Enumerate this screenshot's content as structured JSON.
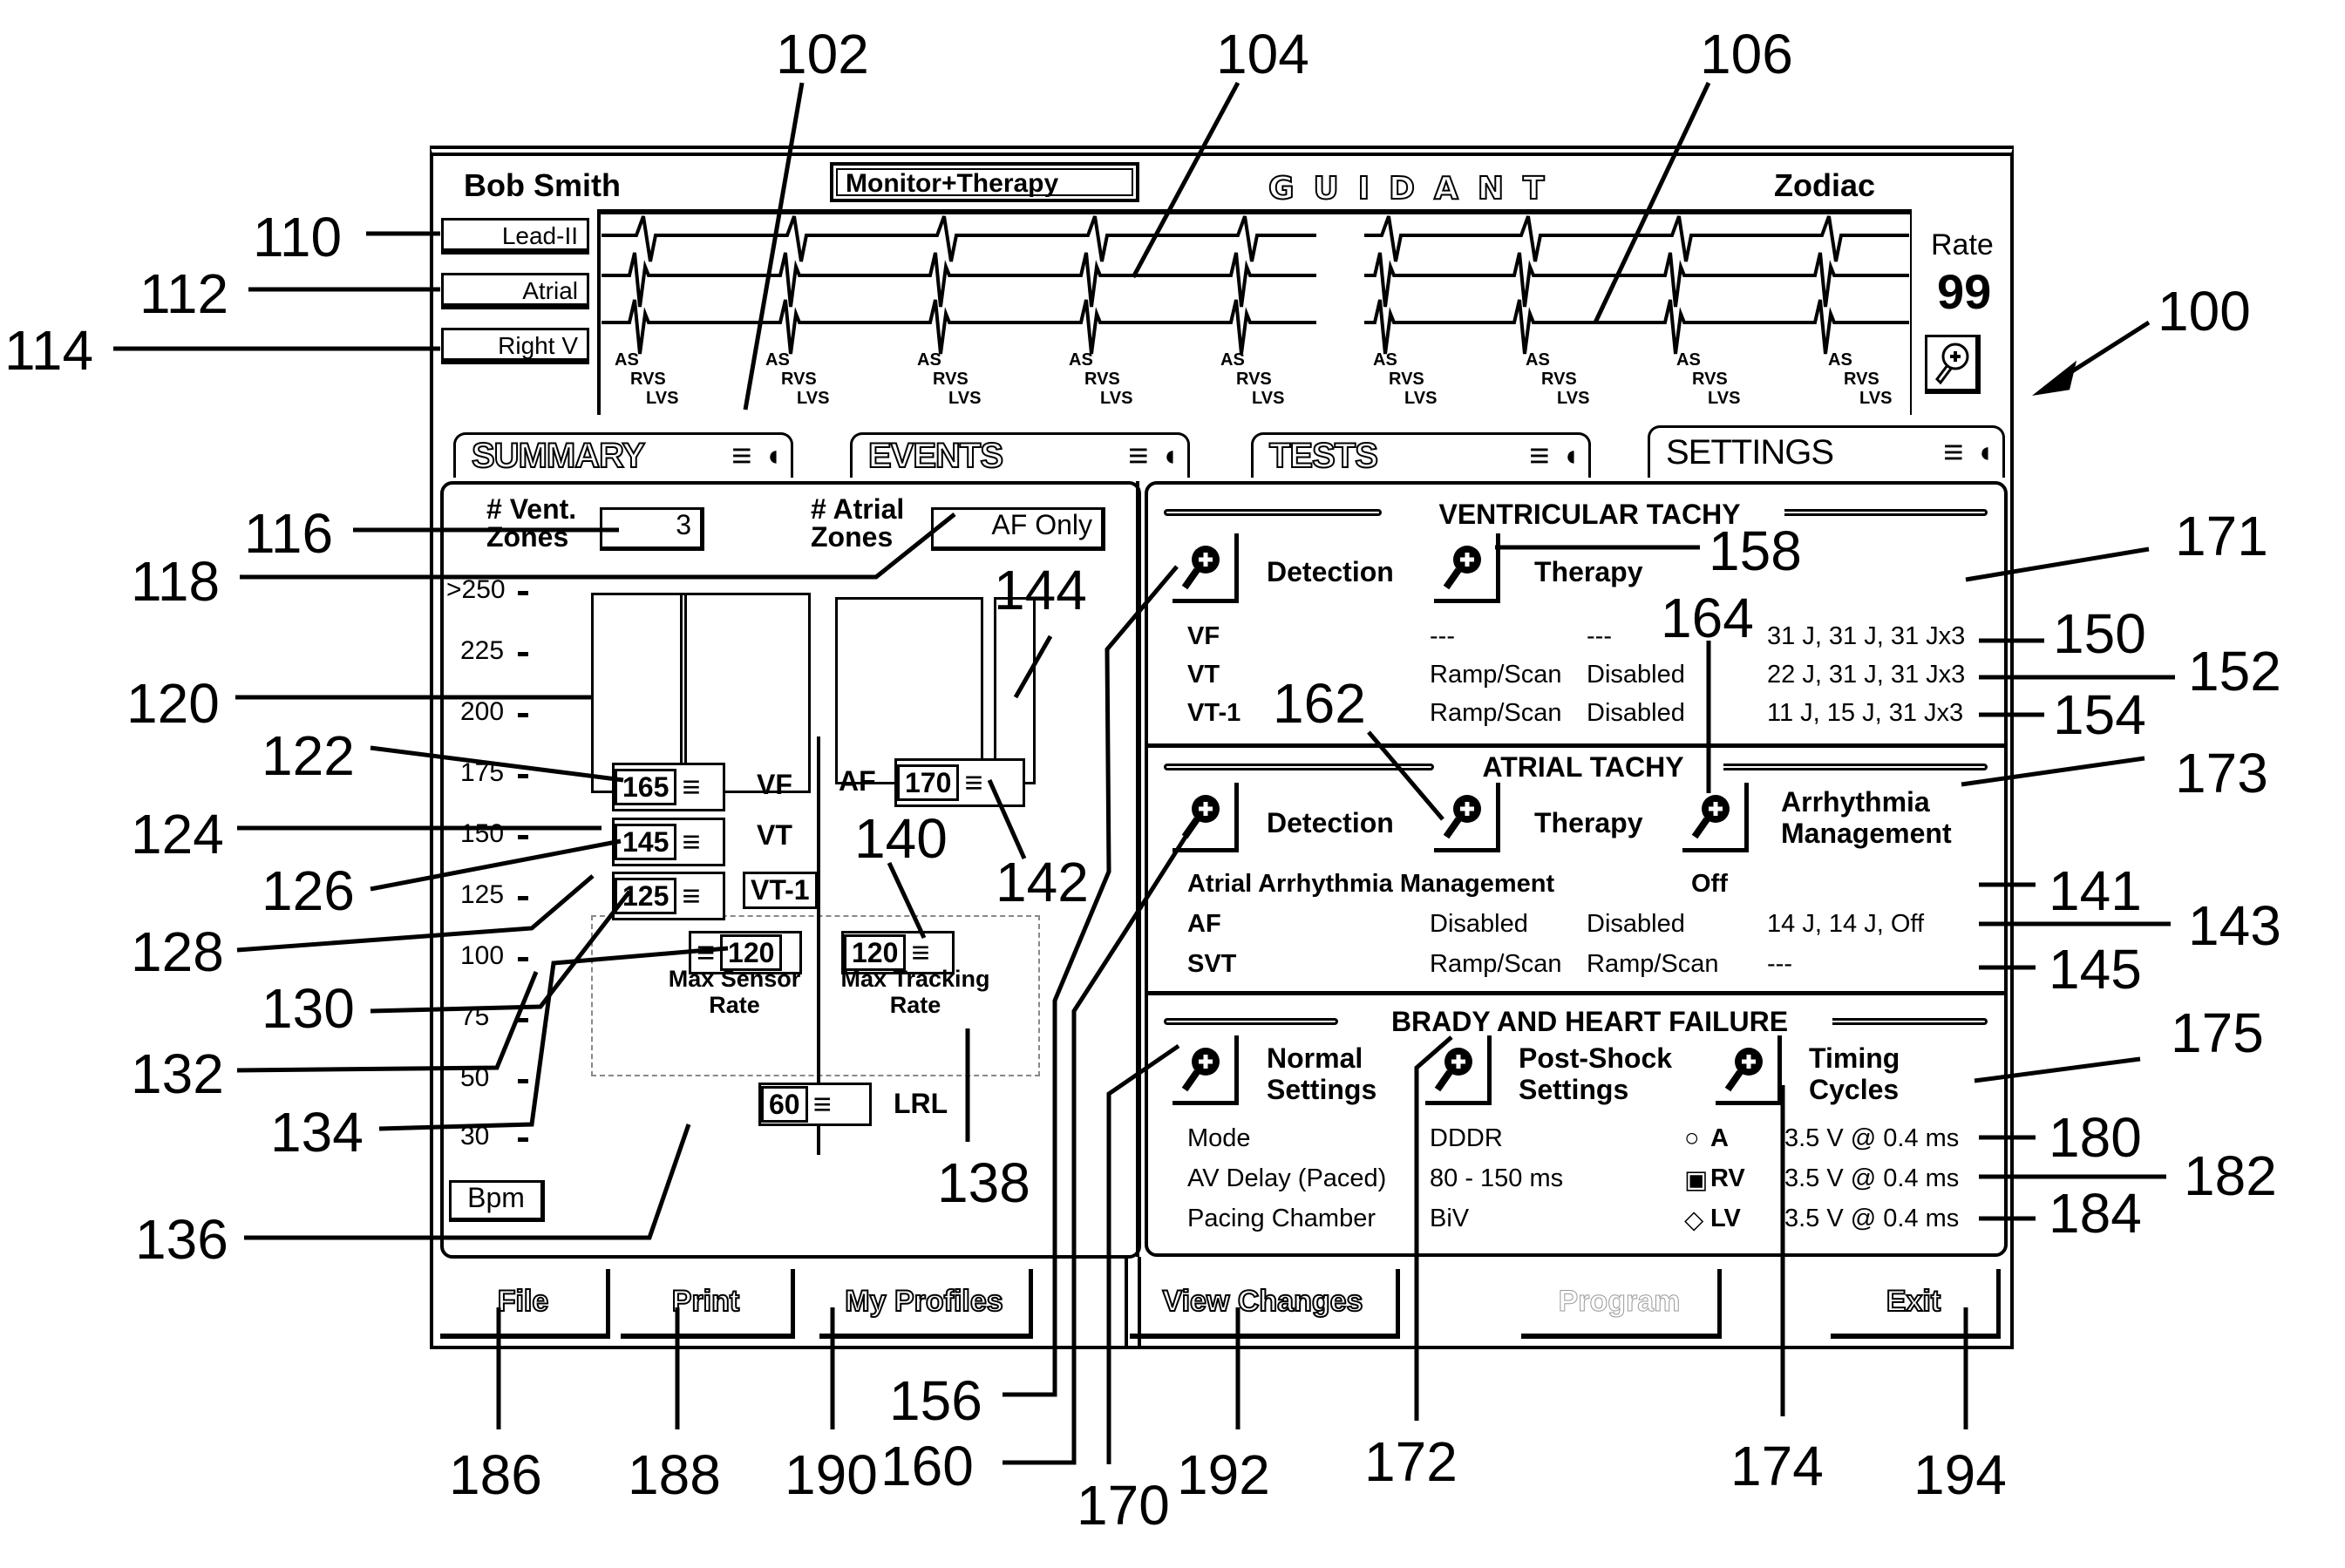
{
  "header": {
    "patient_name": "Bob Smith",
    "mode": "Monitor+Therapy",
    "brand": "GUIDANT",
    "device": "Zodiac"
  },
  "ecg": {
    "lead_buttons": [
      "Lead-II",
      "Atrial",
      "Right V"
    ],
    "markers": [
      {
        "as": "AS",
        "rvs": "RVS",
        "lvs": "LVS"
      },
      {
        "as": "AS",
        "rvs": "RVS",
        "lvs": "LVS"
      },
      {
        "as": "AS",
        "rvs": "RVS",
        "lvs": "LVS"
      },
      {
        "as": "AS",
        "rvs": "RVS",
        "lvs": "LVS"
      },
      {
        "as": "AS",
        "rvs": "RVS",
        "lvs": "LVS"
      },
      {
        "as": "AS",
        "rvs": "RVS",
        "lvs": "LVS"
      },
      {
        "as": "AS",
        "rvs": "RVS",
        "lvs": "LVS"
      },
      {
        "as": "AS",
        "rvs": "RVS",
        "lvs": "LVS"
      },
      {
        "as": "AS",
        "rvs": "RVS",
        "lvs": "LVS"
      }
    ],
    "rate_label": "Rate",
    "rate_value": "99",
    "zoom_icon": "magnifier-icon"
  },
  "tabs": [
    {
      "label": "SUMMARY",
      "active": false
    },
    {
      "label": "EVENTS",
      "active": false
    },
    {
      "label": "TESTS",
      "active": false
    },
    {
      "label": "SETTINGS",
      "active": true
    }
  ],
  "zones": {
    "vent_label_1": "# Vent.",
    "vent_label_2": "Zones",
    "vent_value": "3",
    "atrial_label_1": "# Atrial",
    "atrial_label_2": "Zones",
    "atrial_value": "AF Only",
    "y_ticks": [
      ">250",
      "225",
      "200",
      "175",
      "150",
      "125",
      "100",
      "75",
      "50",
      "30"
    ],
    "units": "Bpm",
    "vf": {
      "value": "165",
      "label": "VF"
    },
    "vt": {
      "value": "145",
      "label": "VT"
    },
    "vt1": {
      "value": "125",
      "label": "VT-1"
    },
    "af": {
      "value": "170",
      "label": "AF"
    },
    "max_sensor": {
      "value": "120",
      "label_1": "Max Sensor",
      "label_2": "Rate"
    },
    "max_tracking": {
      "value": "120",
      "label_1": "Max Tracking",
      "label_2": "Rate"
    },
    "lrl": {
      "value": "60",
      "label": "LRL"
    }
  },
  "ventricular": {
    "title": "VENTRICULAR TACHY",
    "buttons": [
      "Detection",
      "Therapy"
    ],
    "rows": [
      {
        "zone": "VF",
        "c1": "---",
        "c2": "---",
        "shocks": "31 J, 31 J, 31 Jx3"
      },
      {
        "zone": "VT",
        "c1": "Ramp/Scan",
        "c2": "Disabled",
        "shocks": "22 J, 31 J, 31 Jx3"
      },
      {
        "zone": "VT-1",
        "c1": "Ramp/Scan",
        "c2": "Disabled",
        "shocks": "11 J, 15 J, 31 Jx3"
      }
    ]
  },
  "atrial": {
    "title": "ATRIAL TACHY",
    "buttons": [
      "Detection",
      "Therapy",
      "Arrhythmia",
      "Management"
    ],
    "mgmt_label": "Atrial Arrhythmia Management",
    "mgmt_value": "Off",
    "rows": [
      {
        "zone": "AF",
        "c1": "Disabled",
        "c2": "Disabled",
        "shocks": "14 J, 14 J, Off"
      },
      {
        "zone": "SVT",
        "c1": "Ramp/Scan",
        "c2": "Ramp/Scan",
        "shocks": "---"
      }
    ]
  },
  "brady": {
    "title": "BRADY AND HEART FAILURE",
    "buttons": [
      {
        "l1": "Normal",
        "l2": "Settings"
      },
      {
        "l1": "Post-Shock",
        "l2": "Settings"
      },
      {
        "l1": "Timing",
        "l2": "Cycles"
      }
    ],
    "rows": [
      {
        "label": "Mode",
        "value": "DDDR",
        "chamber": "A",
        "symbol": "circle",
        "output": "3.5 V @ 0.4 ms"
      },
      {
        "label": "AV Delay (Paced)",
        "value": "80 - 150 ms",
        "chamber": "RV",
        "symbol": "square",
        "output": "3.5 V @ 0.4 ms"
      },
      {
        "label": "Pacing Chamber",
        "value": "BiV",
        "chamber": "LV",
        "symbol": "diamond",
        "output": "3.5 V @ 0.4 ms"
      }
    ]
  },
  "footer": {
    "buttons": [
      {
        "label": "File",
        "enabled": true
      },
      {
        "label": "Print",
        "enabled": true
      },
      {
        "label": "My Profiles",
        "enabled": true
      },
      {
        "label": "View Changes",
        "enabled": true
      },
      {
        "label": "Program",
        "enabled": false
      },
      {
        "label": "Exit",
        "enabled": true
      }
    ]
  },
  "callouts": {
    "n100": "100",
    "n102": "102",
    "n104": "104",
    "n106": "106",
    "n110": "110",
    "n112": "112",
    "n114": "114",
    "n116": "116",
    "n118": "118",
    "n120": "120",
    "n122": "122",
    "n124": "124",
    "n126": "126",
    "n128": "128",
    "n130": "130",
    "n132": "132",
    "n134": "134",
    "n136": "136",
    "n138": "138",
    "n140": "140",
    "n141": "141",
    "n142": "142",
    "n143": "143",
    "n144": "144",
    "n145": "145",
    "n150": "150",
    "n152": "152",
    "n154": "154",
    "n156": "156",
    "n158": "158",
    "n160": "160",
    "n162": "162",
    "n164": "164",
    "n170": "170",
    "n171": "171",
    "n172": "172",
    "n173": "173",
    "n174": "174",
    "n175": "175",
    "n180": "180",
    "n182": "182",
    "n184": "184",
    "n186": "186",
    "n188": "188",
    "n190": "190",
    "n192": "192",
    "n194": "194"
  }
}
